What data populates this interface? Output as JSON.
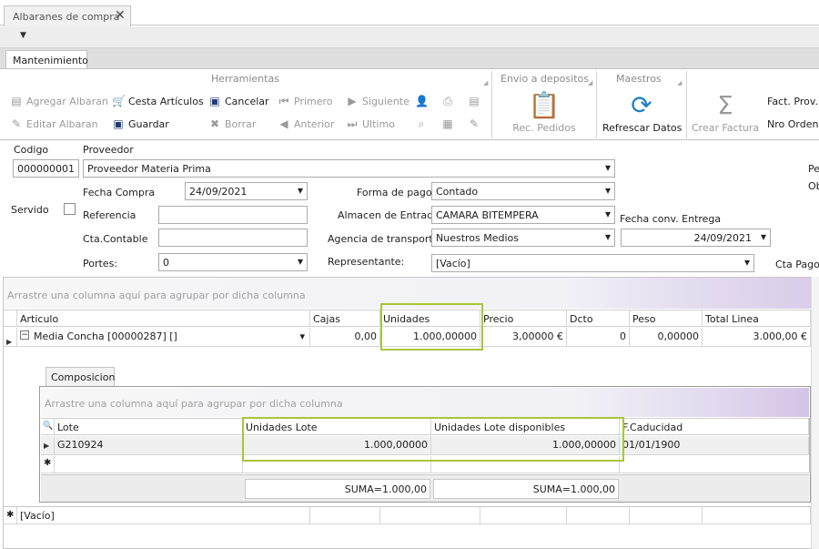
{
  "doc_tab": {
    "title": "Albaranes de compra"
  },
  "ribbon_tabs": [
    "Mantenimiento"
  ],
  "ribbon": {
    "groups": {
      "herramientas": "Herramientas",
      "envio": "Envio a depositos",
      "maestros": "Maestros"
    },
    "agregar_albaran": "Agregar Albaran",
    "editar_albaran": "Editar Albaran",
    "cesta_articulos": "Cesta Artículos",
    "guardar": "Guardar",
    "cancelar": "Cancelar",
    "borrar": "Borrar",
    "primero": "Primero",
    "anterior": "Anterior",
    "siguiente": "Siguiente",
    "ultimo": "Ultimo",
    "rec_pedidos": "Rec. Pedidos",
    "refrescar_datos": "Refrescar Datos",
    "crear_factura": "Crear Factura",
    "fact_prov": "Fact. Prov.",
    "nro_orden": "Nro Orden."
  },
  "form": {
    "codigo_label": "Codigo",
    "codigo_value": "000000001",
    "proveedor_label": "Proveedor",
    "proveedor_value": "Proveedor Materia Prima",
    "servido_label": "Servido",
    "fecha_compra_label": "Fecha Compra",
    "fecha_compra_value": "24/09/2021",
    "referencia_label": "Referencia",
    "cta_contable_label": "Cta.Contable",
    "portes_label": "Portes:",
    "portes_value": "0",
    "forma_pago_label": "Forma de pago",
    "forma_pago_value": "Contado",
    "almacen_label": "Almacen de Entrada",
    "almacen_value": "CAMARA BITEMPERA",
    "agencia_label": "Agencia de transporte",
    "agencia_value": "Nuestros Medios",
    "representante_label": "Representante:",
    "representante_value": "[Vacío]",
    "fecha_conv_label": "Fecha conv. Entrega",
    "fecha_conv_value": "24/09/2021",
    "cta_pago_label": "Cta Pago",
    "right_cut_1": "Pe",
    "right_cut_2": "Ob"
  },
  "main_grid": {
    "group_hint": "Arrastre una columna aquí para agrupar por dicha columna",
    "columns": [
      "Articulo",
      "Cajas",
      "Unidades",
      "Precio",
      "Dcto",
      "Peso",
      "Total Linea"
    ],
    "row": {
      "articulo": "Media Concha [00000287] []",
      "cajas": "0,00",
      "unidades": "1.000,00000",
      "precio": "3,00000 €",
      "dcto": "0",
      "peso": "0,00000",
      "total": "3.000,00 €"
    },
    "footer_value": "[Vacío]"
  },
  "detail": {
    "tab": "Composicion",
    "group_hint": "Arrastre una columna aquí para agrupar por dicha columna",
    "columns": [
      "Lote",
      "Unidades Lote",
      "Unidades Lote disponibles",
      "F.Caducidad"
    ],
    "row": {
      "lote": "G210924",
      "unidades_lote": "1.000,00000",
      "disponibles": "1.000,00000",
      "caducidad": "01/01/1900"
    },
    "sum_1": "SUMA=1.000,00",
    "sum_2": "SUMA=1.000,00"
  },
  "colors": {
    "highlight": "#a8c63a",
    "accent_orange": "#e8833a"
  }
}
